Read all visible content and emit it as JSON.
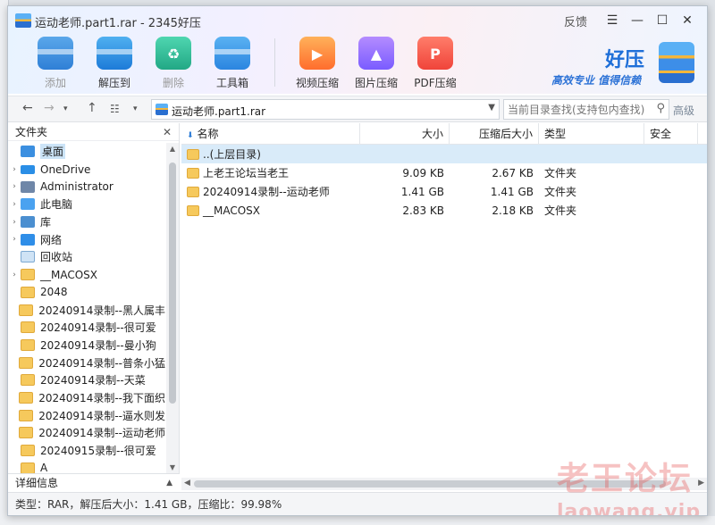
{
  "window": {
    "title": "运动老师.part1.rar - 2345好压",
    "feedback": "反馈"
  },
  "toolbar": [
    {
      "label": "添加",
      "icon": "add-archive-icon",
      "disabled": true
    },
    {
      "label": "解压到",
      "icon": "extract-icon",
      "disabled": false
    },
    {
      "label": "删除",
      "icon": "recycle-delete-icon",
      "disabled": true
    },
    {
      "label": "工具箱",
      "icon": "toolbox-icon",
      "disabled": false
    }
  ],
  "toolbar2": [
    {
      "label": "视频压缩",
      "icon": "video-compress-icon"
    },
    {
      "label": "图片压缩",
      "icon": "image-compress-icon"
    },
    {
      "label": "PDF压缩",
      "icon": "pdf-compress-icon"
    }
  ],
  "brand": {
    "name": "好压",
    "slogan": "高效专业  值得信赖"
  },
  "address": {
    "path": "运动老师.part1.rar",
    "search_placeholder": "当前目录查找(支持包内查找)",
    "advanced": "高级"
  },
  "tree": {
    "header": "文件夹",
    "items": [
      {
        "label": "桌面",
        "icon": "desktop-icon",
        "arrow": "",
        "selected": true
      },
      {
        "label": "OneDrive",
        "icon": "onedrive-cloud-icon",
        "arrow": "›"
      },
      {
        "label": "Administrator",
        "icon": "user-icon",
        "arrow": "›"
      },
      {
        "label": "此电脑",
        "icon": "computer-icon",
        "arrow": "›"
      },
      {
        "label": "库",
        "icon": "library-icon",
        "arrow": "›"
      },
      {
        "label": "网络",
        "icon": "network-icon",
        "arrow": "›"
      },
      {
        "label": "回收站",
        "icon": "recycle-bin-icon",
        "arrow": ""
      },
      {
        "label": "__MACOSX",
        "icon": "folder-icon",
        "arrow": "›"
      },
      {
        "label": "2048",
        "icon": "folder-icon",
        "arrow": ""
      },
      {
        "label": "20240914录制--黑人属丰",
        "icon": "folder-icon",
        "arrow": ""
      },
      {
        "label": "20240914录制--很可爱",
        "icon": "folder-icon",
        "arrow": ""
      },
      {
        "label": "20240914录制--曼小狗",
        "icon": "folder-icon",
        "arrow": ""
      },
      {
        "label": "20240914录制--普条小猛",
        "icon": "folder-icon",
        "arrow": ""
      },
      {
        "label": "20240914录制--天菜",
        "icon": "folder-icon",
        "arrow": ""
      },
      {
        "label": "20240914录制--我下面织",
        "icon": "folder-icon",
        "arrow": ""
      },
      {
        "label": "20240914录制--逼水则发",
        "icon": "folder-icon",
        "arrow": ""
      },
      {
        "label": "20240914录制--运动老师",
        "icon": "folder-icon",
        "arrow": ""
      },
      {
        "label": "20240915录制--很可爱",
        "icon": "folder-icon",
        "arrow": ""
      },
      {
        "label": "A",
        "icon": "folder-icon",
        "arrow": ""
      }
    ]
  },
  "details": {
    "label": "详细信息"
  },
  "columns": {
    "name": "名称",
    "size": "大小",
    "csize": "压缩后大小",
    "type": "类型",
    "security": "安全"
  },
  "files": [
    {
      "name": "..(上层目录)",
      "size": "",
      "csize": "",
      "type": "",
      "selected": true
    },
    {
      "name": "上老王论坛当老王",
      "size": "9.09 KB",
      "csize": "2.67 KB",
      "type": "文件夹"
    },
    {
      "name": "20240914录制--运动老师",
      "size": "1.41 GB",
      "csize": "1.41 GB",
      "type": "文件夹"
    },
    {
      "name": "__MACOSX",
      "size": "2.83 KB",
      "csize": "2.18 KB",
      "type": "文件夹"
    }
  ],
  "status": "类型：RAR，解压后大小：1.41 GB，压缩比：99.98%",
  "watermark": {
    "line1": "老王论坛",
    "line2": "laowang.vip"
  }
}
